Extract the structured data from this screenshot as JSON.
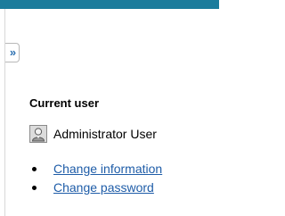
{
  "colors": {
    "topbar": "#1b7c9c",
    "link": "#1f5da8",
    "expander_glyph": "#2a6fb0"
  },
  "sidebar": {
    "expander_label": "»",
    "section_title": "Current user",
    "user": {
      "avatar_icon": "user-avatar-icon",
      "name": "Administrator User"
    },
    "links": [
      {
        "label": "Change information"
      },
      {
        "label": "Change password"
      }
    ]
  }
}
